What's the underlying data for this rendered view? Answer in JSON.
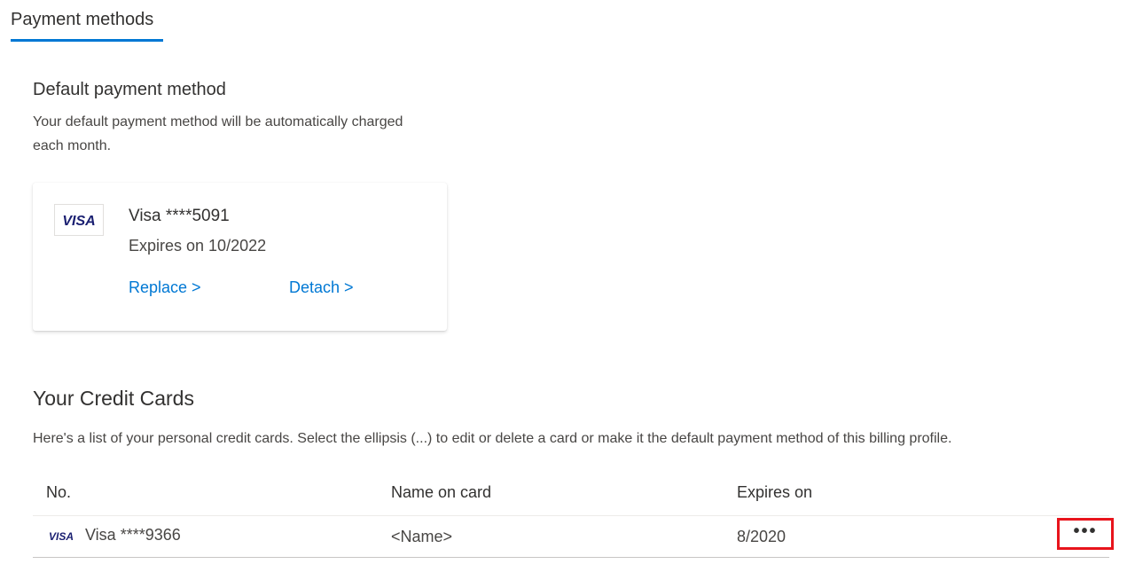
{
  "tab": {
    "label": "Payment methods"
  },
  "default_section": {
    "title": "Default payment method",
    "description": "Your default payment method will be automatically charged each month."
  },
  "default_card": {
    "brand_icon": "visa-logo",
    "name": "Visa ****5091",
    "expiry": "Expires on 10/2022",
    "replace_label": "Replace >",
    "detach_label": "Detach >"
  },
  "credit_cards": {
    "title": "Your Credit Cards",
    "description": "Here's a list of your personal credit cards. Select the ellipsis (...) to edit or delete a card or make it the default payment method of this billing profile.",
    "columns": [
      "No.",
      "Name on card",
      "Expires on"
    ],
    "rows": [
      {
        "number": "Visa ****9366",
        "name": "<Name>",
        "expires": "8/2020",
        "more_icon": "ellipsis-icon",
        "more_label": "•••"
      }
    ]
  },
  "colors": {
    "accent": "#0078d4",
    "highlight_border": "#e8141c",
    "visa_blue": "#1a1f71"
  }
}
